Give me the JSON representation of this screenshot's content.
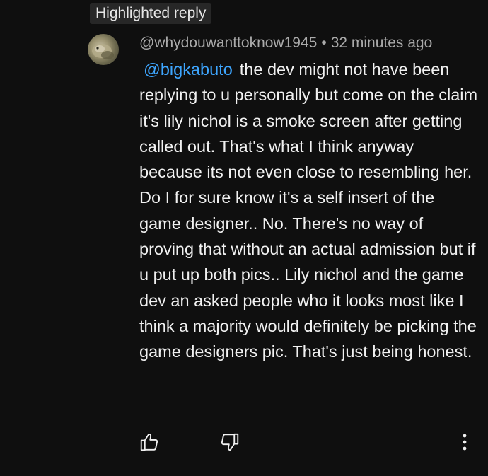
{
  "badge": {
    "label": "Highlighted reply"
  },
  "comment": {
    "author": "@whydouwanttoknow1945",
    "separator": "•",
    "timestamp": "32 minutes ago",
    "mention": "@bigkabuto",
    "text": "the dev might not have been replying to u personally but come on the claim it's lily nichol is a smoke screen after getting called out. That's what I think anyway because its not even close to resembling her. Do I for sure know it's a self insert of the game designer.. No. There's no way of proving that without an actual admission but if u put up both pics.. Lily nichol and the game dev an asked people who it looks most like I think a majority would definitely be picking the game designers pic. That's just being honest."
  },
  "actions": {
    "like_icon": "thumbs-up-icon",
    "dislike_icon": "thumbs-down-icon",
    "more_icon": "vertical-ellipsis-icon"
  },
  "colors": {
    "background": "#0f0f0f",
    "text": "#f1f1f1",
    "meta": "#aaaaaa",
    "mention": "#3ea6ff",
    "badge_bg": "#272727"
  }
}
